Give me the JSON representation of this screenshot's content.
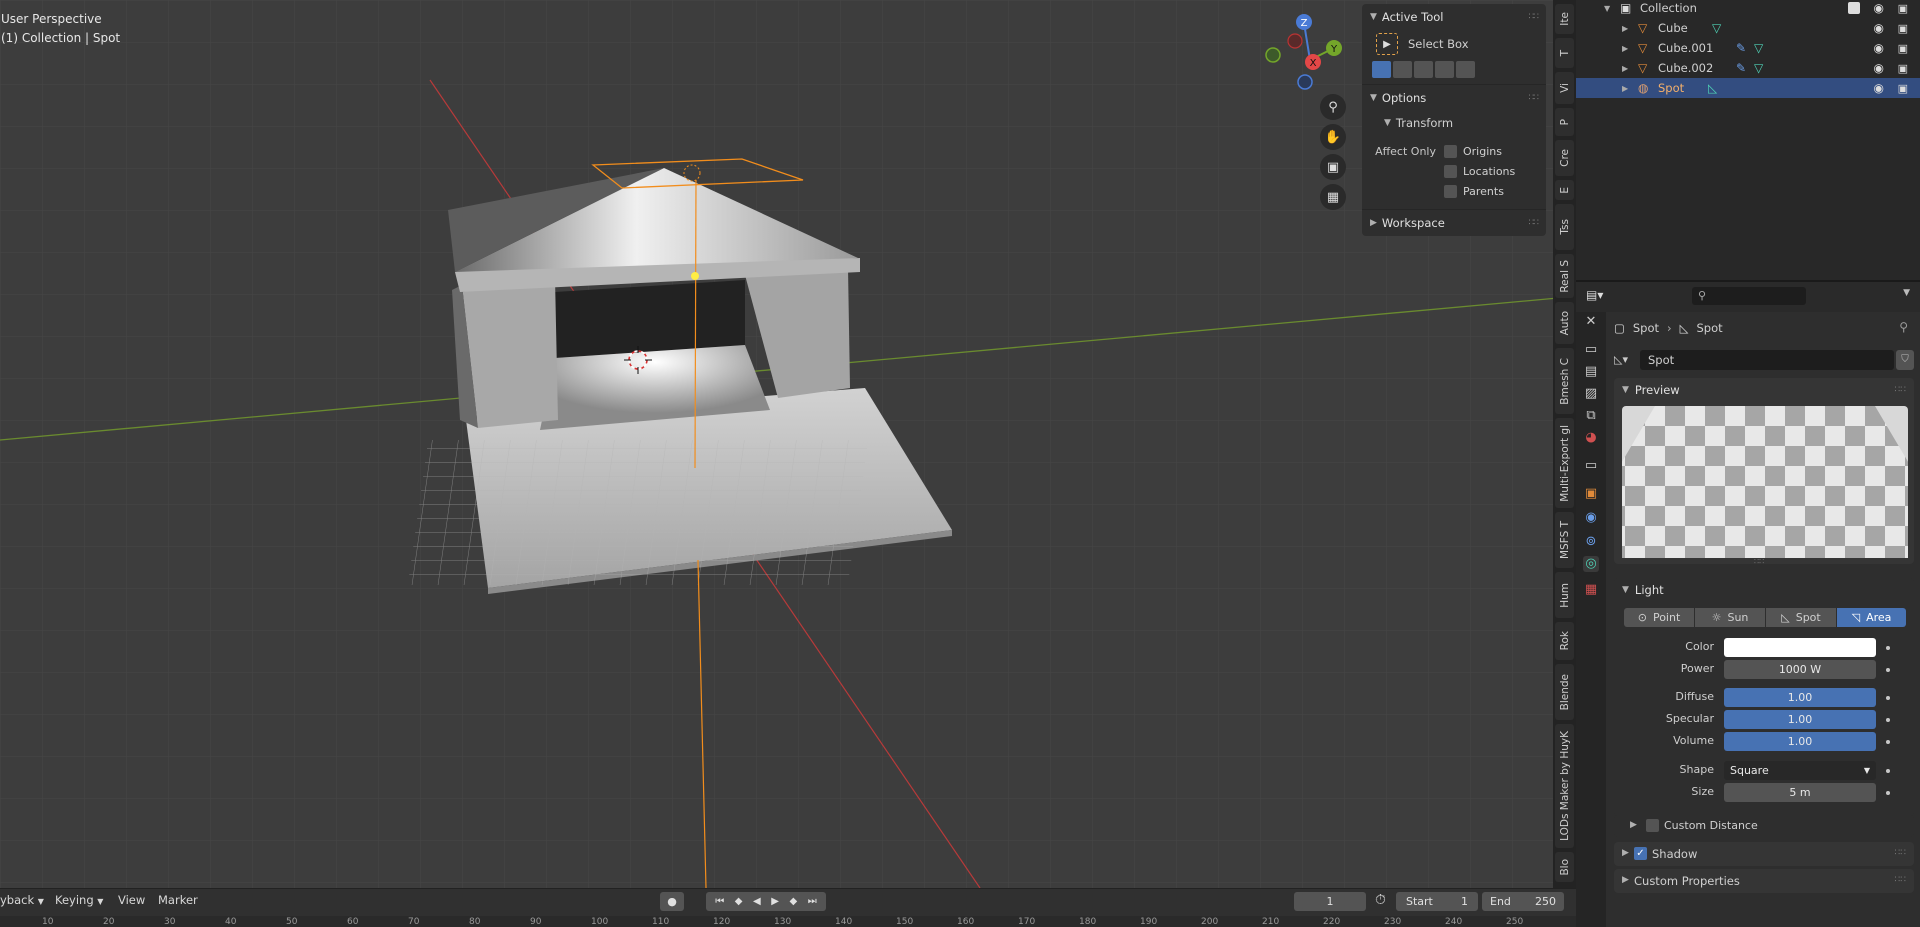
{
  "viewport": {
    "perspective_label": "User Perspective",
    "context_label": "(1) Collection | Spot"
  },
  "npanel": {
    "active_tool": {
      "title": "Active Tool",
      "tool_name": "Select Box"
    },
    "options": {
      "title": "Options",
      "transform": "Transform",
      "affect_only": "Affect Only",
      "origins": "Origins",
      "locations": "Locations",
      "parents": "Parents"
    },
    "workspace": "Workspace"
  },
  "gizmo": {
    "z": "Z",
    "y": "Y",
    "x": "X"
  },
  "vtabs": [
    "Ite",
    "T",
    "Vi",
    "P",
    "Cre",
    "E",
    "Tss",
    "Real S",
    "Auto",
    "Bmesh C",
    "Multi-Export gl",
    "MSFS T",
    "Hum",
    "Rok",
    "Blende",
    "LODs Maker by HuyK",
    "Blo"
  ],
  "timeline": {
    "menus": [
      "yback",
      "Keying",
      "View",
      "Marker"
    ],
    "current_frame": "1",
    "start_label": "Start",
    "start_value": "1",
    "end_label": "End",
    "end_value": "250",
    "ruler_numbers": [
      "10",
      "20",
      "30",
      "40",
      "50",
      "60",
      "70",
      "80",
      "90",
      "100",
      "110",
      "120",
      "130",
      "140",
      "150",
      "160",
      "170",
      "180",
      "190",
      "200",
      "210",
      "220",
      "230",
      "240",
      "250"
    ]
  },
  "outliner": {
    "rows": [
      {
        "name": "Collection"
      },
      {
        "name": "Cube"
      },
      {
        "name": "Cube.001"
      },
      {
        "name": "Cube.002"
      },
      {
        "name": "Spot"
      }
    ]
  },
  "properties": {
    "breadcrumb_object": "Spot",
    "breadcrumb_data": "Spot",
    "datablock_name": "Spot",
    "preview_title": "Preview",
    "light": {
      "title": "Light",
      "types": [
        "Point",
        "Sun",
        "Spot",
        "Area"
      ],
      "active_type": "Area",
      "color_label": "Color",
      "color_value": "#ffffff",
      "power_label": "Power",
      "power_value": "1000 W",
      "diffuse_label": "Diffuse",
      "diffuse_value": "1.00",
      "specular_label": "Specular",
      "specular_value": "1.00",
      "volume_label": "Volume",
      "volume_value": "1.00",
      "shape_label": "Shape",
      "shape_value": "Square",
      "size_label": "Size",
      "size_value": "5 m",
      "custom_distance": "Custom Distance"
    },
    "shadow": "Shadow",
    "custom_properties": "Custom Properties"
  },
  "colors": {
    "accent_blue": "#4772b3",
    "selection_orange": "#f28d1c",
    "axis_red": "#b73a3a",
    "axis_green": "#6a8b2f"
  }
}
